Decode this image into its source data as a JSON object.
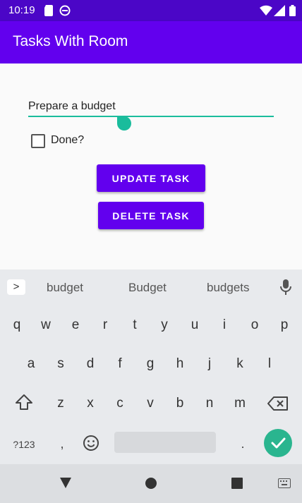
{
  "status_bar": {
    "time": "10:19",
    "icons_left": [
      "sd-card-icon",
      "do-not-disturb-icon"
    ],
    "icons_right": [
      "wifi-icon",
      "cellular-signal-icon",
      "battery-icon"
    ]
  },
  "app_bar": {
    "title": "Tasks With Room"
  },
  "form": {
    "task_value": "Prepare a budget",
    "done_label": "Done?",
    "done_checked": false,
    "update_button_label": "UPDATE TASK",
    "delete_button_label": "DELETE TASK"
  },
  "keyboard": {
    "expand_label": ">",
    "suggestions": [
      "budget",
      "Budget",
      "budgets"
    ],
    "row1": [
      "q",
      "w",
      "e",
      "r",
      "t",
      "y",
      "u",
      "i",
      "o",
      "p"
    ],
    "row2": [
      "a",
      "s",
      "d",
      "f",
      "g",
      "h",
      "j",
      "k",
      "l"
    ],
    "row3": [
      "z",
      "x",
      "c",
      "v",
      "b",
      "n",
      "m"
    ],
    "symbols_label": "?123",
    "comma_label": ",",
    "period_label": "."
  },
  "colors": {
    "accent": "#6200ee",
    "status_bar": "#4b06c7",
    "text_cursor": "#1abc9c",
    "enter_key": "#2ab58f"
  }
}
